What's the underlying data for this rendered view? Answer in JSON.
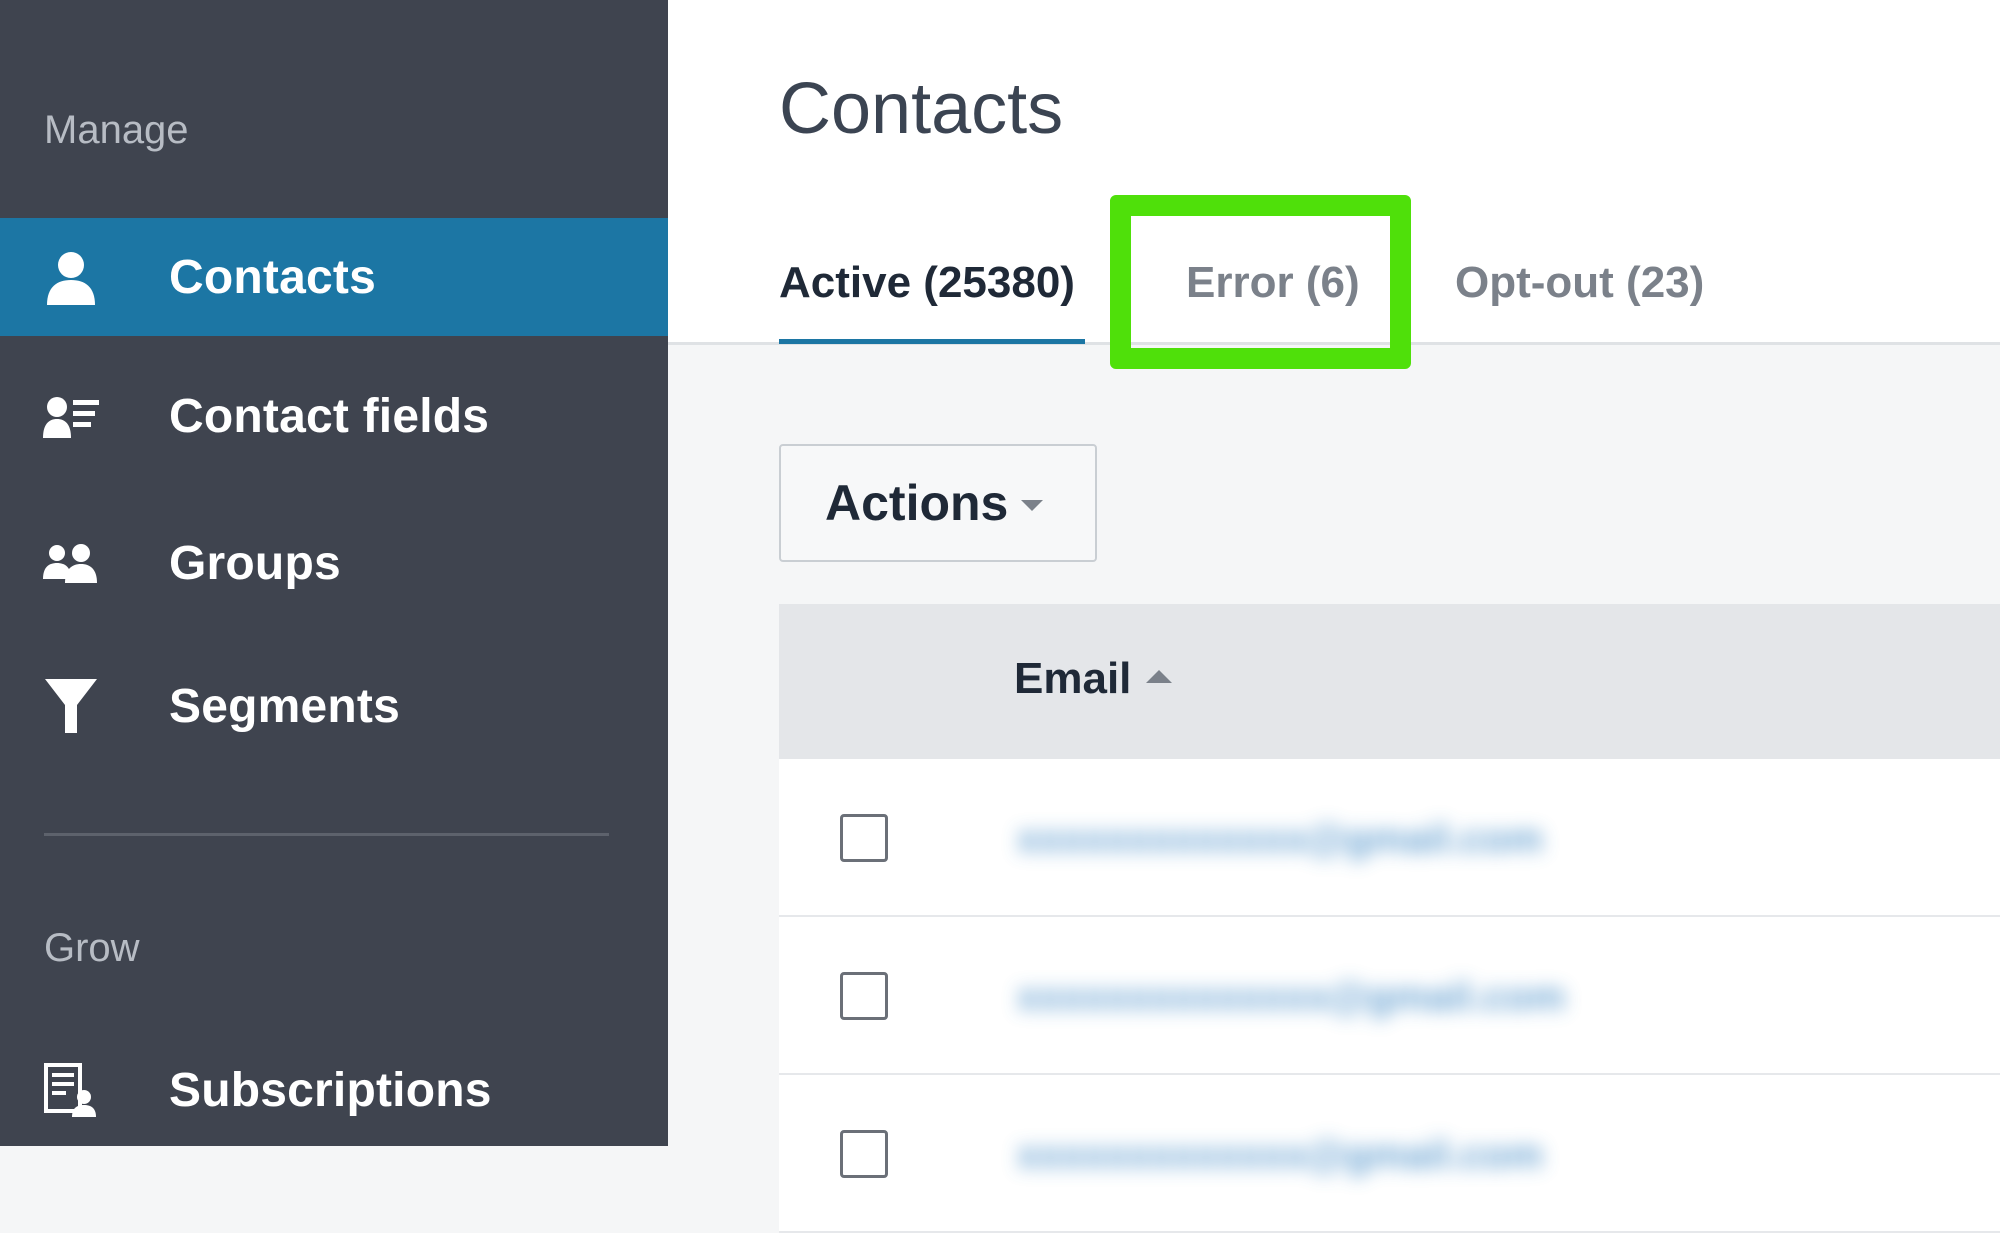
{
  "sidebar": {
    "sections": [
      {
        "label": "Manage",
        "items": [
          {
            "label": "Contacts",
            "icon": "person-icon",
            "active": true
          },
          {
            "label": "Contact fields",
            "icon": "contact-fields-icon",
            "active": false
          },
          {
            "label": "Groups",
            "icon": "groups-icon",
            "active": false
          },
          {
            "label": "Segments",
            "icon": "filter-icon",
            "active": false
          }
        ]
      },
      {
        "label": "Grow",
        "items": [
          {
            "label": "Subscriptions",
            "icon": "subscriptions-icon",
            "active": false
          }
        ]
      }
    ]
  },
  "main": {
    "title": "Contacts",
    "tabs": [
      {
        "label": "Active (25380)",
        "active": true
      },
      {
        "label": "Error (6)",
        "active": false,
        "highlighted": true
      },
      {
        "label": "Opt-out (23)",
        "active": false
      }
    ],
    "actions_label": "Actions",
    "table": {
      "columns": [
        "Email"
      ],
      "sort": "ascending",
      "rows": [
        {
          "email": "xxxxxxxxxxxxx@gmail.com"
        },
        {
          "email": "xxxxxxxxxxxxxx@gmail.com"
        },
        {
          "email": "xxxxxxxxxxxxx@gmail.com"
        }
      ]
    }
  },
  "colors": {
    "sidebar_bg": "#3f444f",
    "active_nav": "#1c76a4",
    "highlight": "#4fe00a",
    "link": "#3b86c4"
  }
}
